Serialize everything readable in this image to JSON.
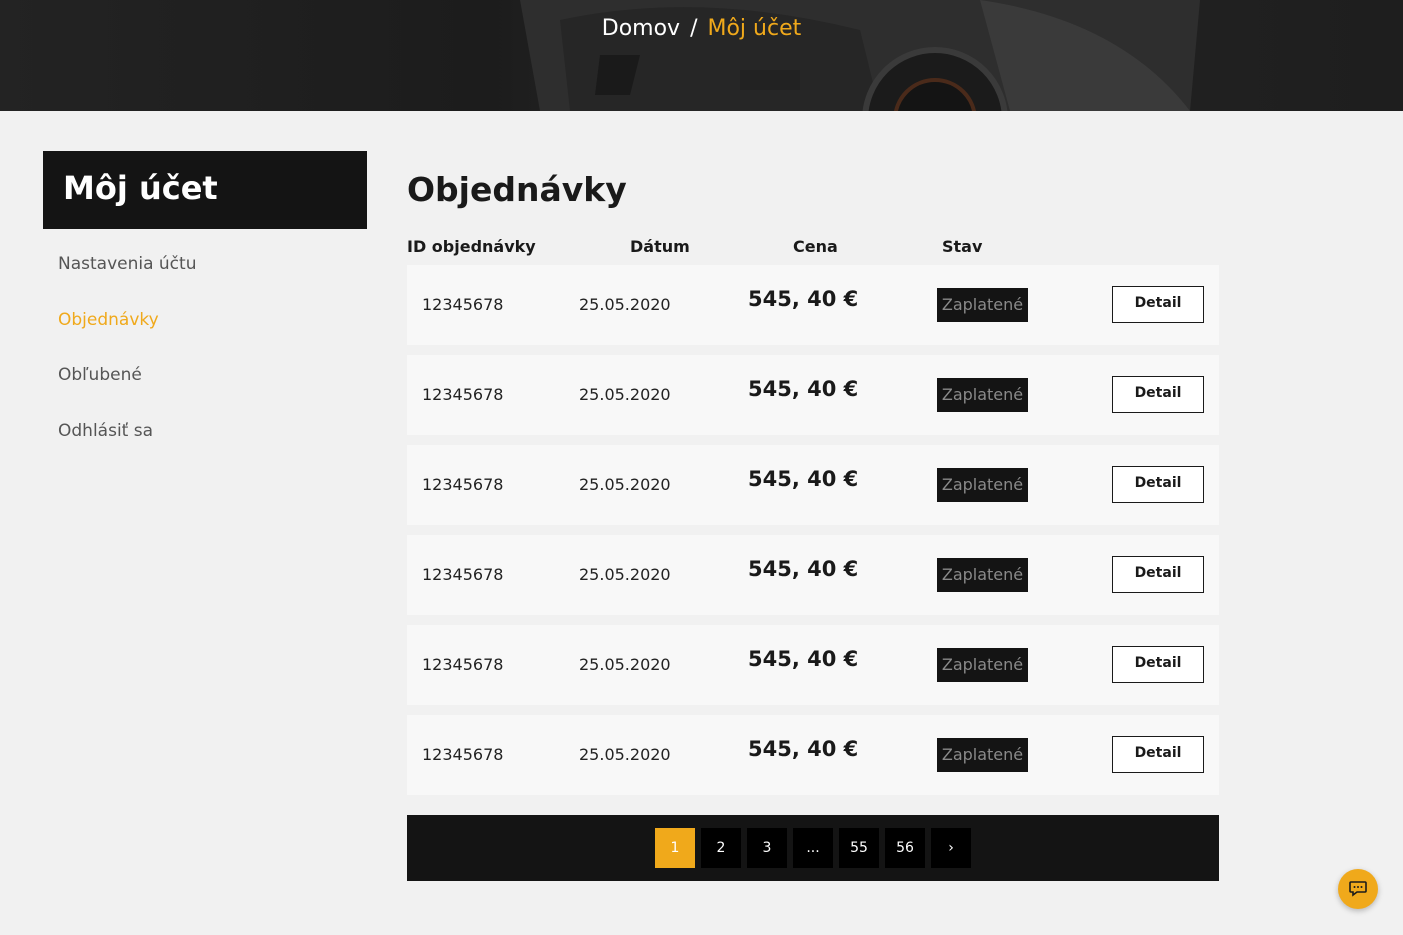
{
  "breadcrumb": {
    "home": "Domov",
    "separator": "/",
    "current": "Môj účet"
  },
  "sidebar": {
    "title": "Môj účet",
    "items": [
      {
        "label": "Nastavenia účtu",
        "active": false
      },
      {
        "label": "Objednávky",
        "active": true
      },
      {
        "label": "Obľubené",
        "active": false
      },
      {
        "label": "Odhlásiť sa",
        "active": false
      }
    ]
  },
  "orders": {
    "title": "Objednávky",
    "columns": {
      "id": "ID objednávky",
      "date": "Dátum",
      "price": "Cena",
      "status": "Stav"
    },
    "rows": [
      {
        "id": "12345678",
        "date": "25.05.2020",
        "price": "545, 40 €",
        "status": "Zaplatené",
        "action": "Detail"
      },
      {
        "id": "12345678",
        "date": "25.05.2020",
        "price": "545, 40 €",
        "status": "Zaplatené",
        "action": "Detail"
      },
      {
        "id": "12345678",
        "date": "25.05.2020",
        "price": "545, 40 €",
        "status": "Zaplatené",
        "action": "Detail"
      },
      {
        "id": "12345678",
        "date": "25.05.2020",
        "price": "545, 40 €",
        "status": "Zaplatené",
        "action": "Detail"
      },
      {
        "id": "12345678",
        "date": "25.05.2020",
        "price": "545, 40 €",
        "status": "Zaplatené",
        "action": "Detail"
      },
      {
        "id": "12345678",
        "date": "25.05.2020",
        "price": "545, 40 €",
        "status": "Zaplatené",
        "action": "Detail"
      }
    ]
  },
  "pagination": {
    "pages": [
      "1",
      "2",
      "3",
      "...",
      "55",
      "56"
    ],
    "current": "1",
    "next": "›"
  },
  "chat": {
    "icon": "chat-icon"
  },
  "colors": {
    "accent": "#f0a91b",
    "dark": "#141414",
    "background": "#f1f1f1"
  }
}
